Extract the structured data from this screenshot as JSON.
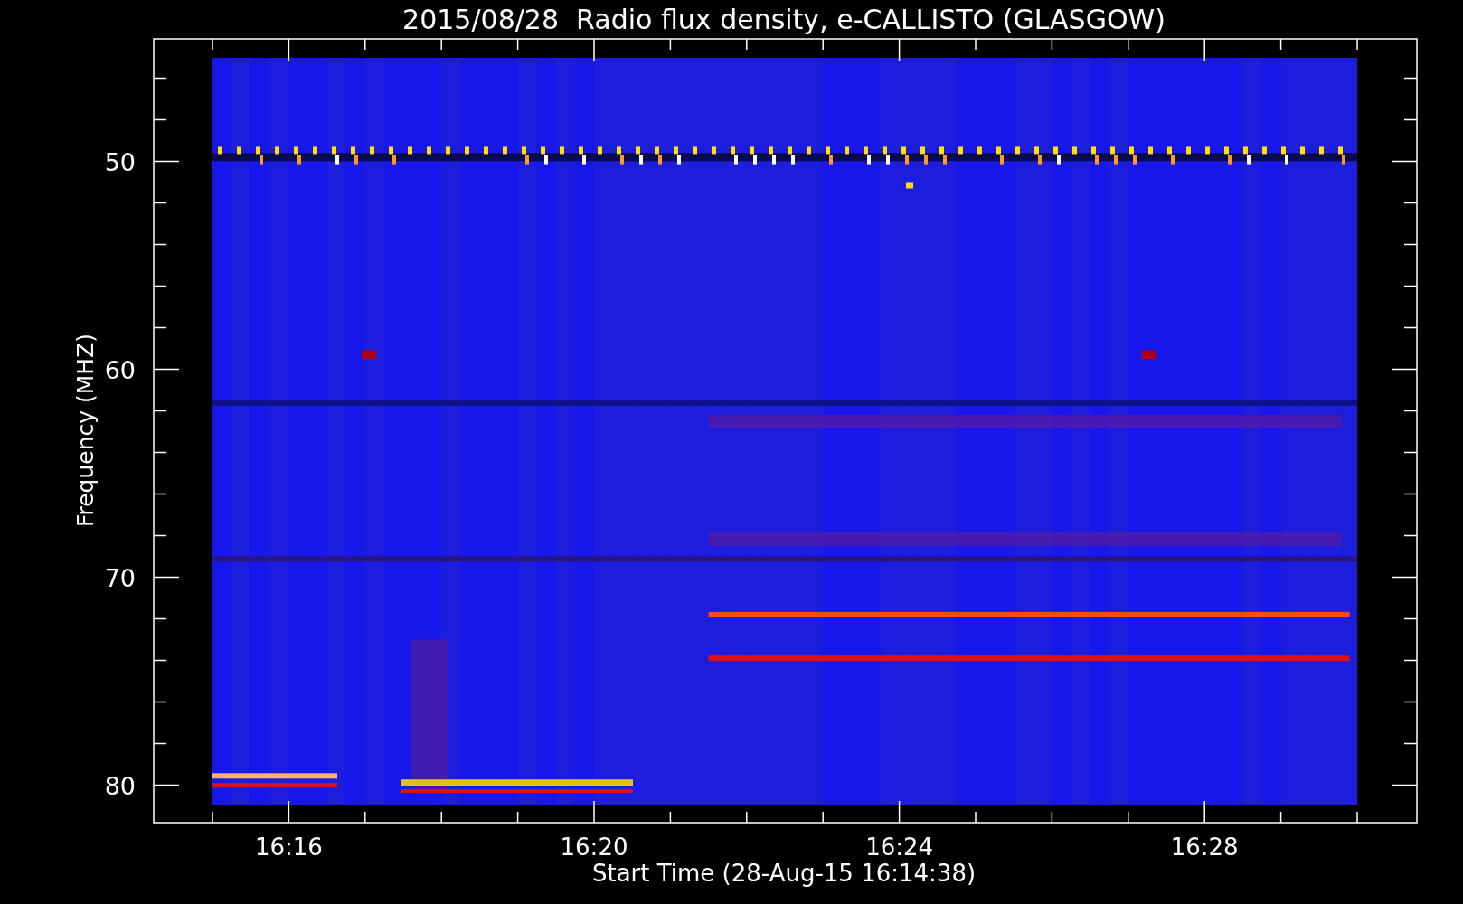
{
  "title": "2015/08/28  Radio flux density, e-CALLISTO (GLASGOW)",
  "y_axis": {
    "label": "Frequency (MHZ)",
    "ticks": [
      "50",
      "60",
      "70",
      "80"
    ]
  },
  "x_axis": {
    "label": "Start Time (28-Aug-15 16:14:38)",
    "ticks": [
      "16:16",
      "16:20",
      "16:24",
      "16:28"
    ]
  }
}
